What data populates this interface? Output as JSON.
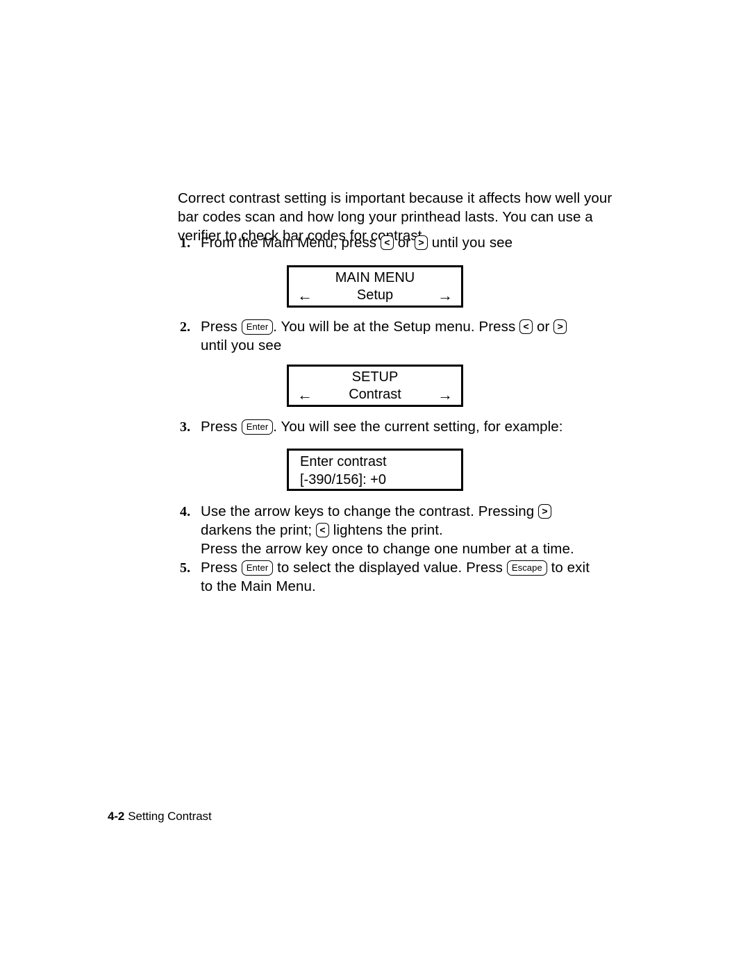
{
  "document": {
    "intro_paragraph": "Correct contrast setting is important because it affects how well your bar codes scan and how long your printhead lasts.  You can use a verifier to check bar codes for contrast."
  },
  "keys": {
    "enter": "Enter",
    "escape": "Escape",
    "left_arrow": "<",
    "right_arrow": ">"
  },
  "steps": [
    {
      "number": "1.",
      "text_before_keys": "From the Main Menu, press ",
      "text_between_keys": " or ",
      "text_after_keys": " until you see"
    },
    {
      "number": "2.",
      "line1_a": "Press ",
      "line1_b": ".  You will be at the Setup menu.  Press ",
      "line1_c": " or ",
      "line2": "until you see"
    },
    {
      "number": "3.",
      "line1_a": "Press ",
      "line1_b": ".  You will see the current setting, for example:"
    },
    {
      "number": "4.",
      "line1_a": "Use the arrow keys to change the contrast.  Pressing ",
      "line2_a": "darkens the print; ",
      "line2_b": " lightens the print.",
      "line3": "Press the arrow key once to change one number at a time."
    },
    {
      "number": "5.",
      "line1_a": "Press ",
      "line1_b": " to select the displayed value.  Press ",
      "line1_c": " to exit",
      "line2": "to the Main Menu."
    }
  ],
  "displays": {
    "main_menu": {
      "title": "MAIN MENU",
      "left_arrow": "←",
      "value": "Setup",
      "right_arrow": "→"
    },
    "setup": {
      "title": "SETUP",
      "left_arrow": "←",
      "value": "Contrast",
      "right_arrow": "→"
    },
    "contrast": {
      "line1": "Enter contrast",
      "line2": "[-390/156]:  +0"
    }
  },
  "footer": {
    "page_number": "4-2",
    "section_title": "Setting Contrast"
  }
}
